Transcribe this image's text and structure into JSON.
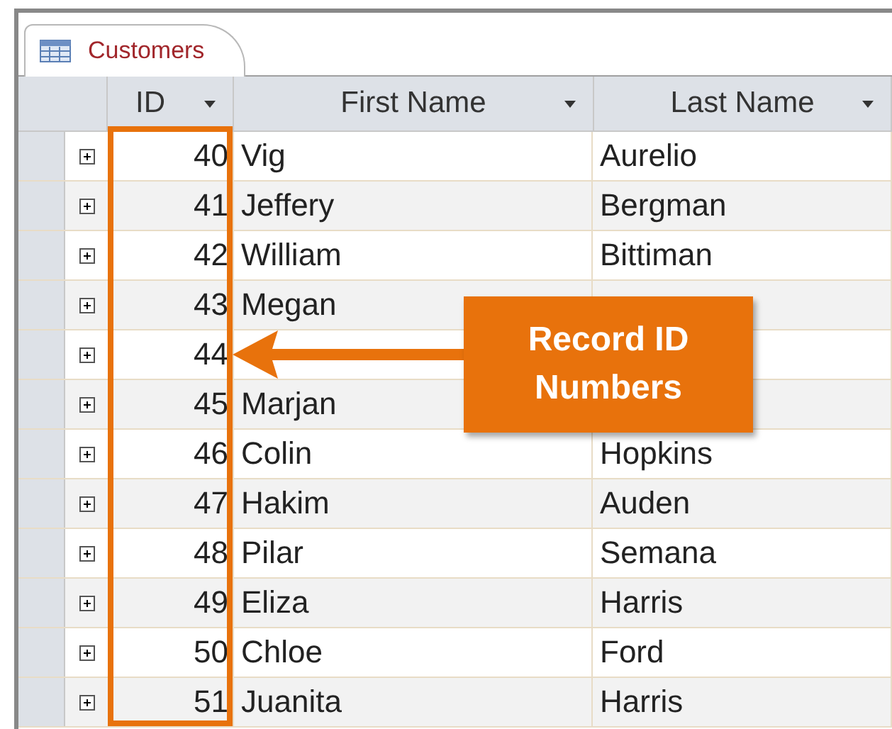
{
  "tab": {
    "label": "Customers",
    "selected": true
  },
  "table": {
    "columns": [
      {
        "label": "ID"
      },
      {
        "label": "First Name"
      },
      {
        "label": "Last Name"
      }
    ],
    "rows": [
      {
        "id": "40",
        "first": "Vig",
        "last": "Aurelio"
      },
      {
        "id": "41",
        "first": "Jeffery",
        "last": "Bergman"
      },
      {
        "id": "42",
        "first": "William",
        "last": "Bittiman"
      },
      {
        "id": "43",
        "first": "Megan"
      },
      {
        "id": "44"
      },
      {
        "id": "45",
        "first": "Marjan"
      },
      {
        "id": "46",
        "first": "Colin",
        "last": "Hopkins"
      },
      {
        "id": "47",
        "first": "Hakim",
        "last": "Auden"
      },
      {
        "id": "48",
        "first": "Pilar",
        "last": "Semana"
      },
      {
        "id": "49",
        "first": "Eliza",
        "last": "Harris"
      },
      {
        "id": "50",
        "first": "Chloe",
        "last": "Ford"
      },
      {
        "id": "51",
        "first": "Juanita",
        "last": "Harris"
      }
    ]
  },
  "callout": {
    "text": "Record ID Numbers"
  }
}
